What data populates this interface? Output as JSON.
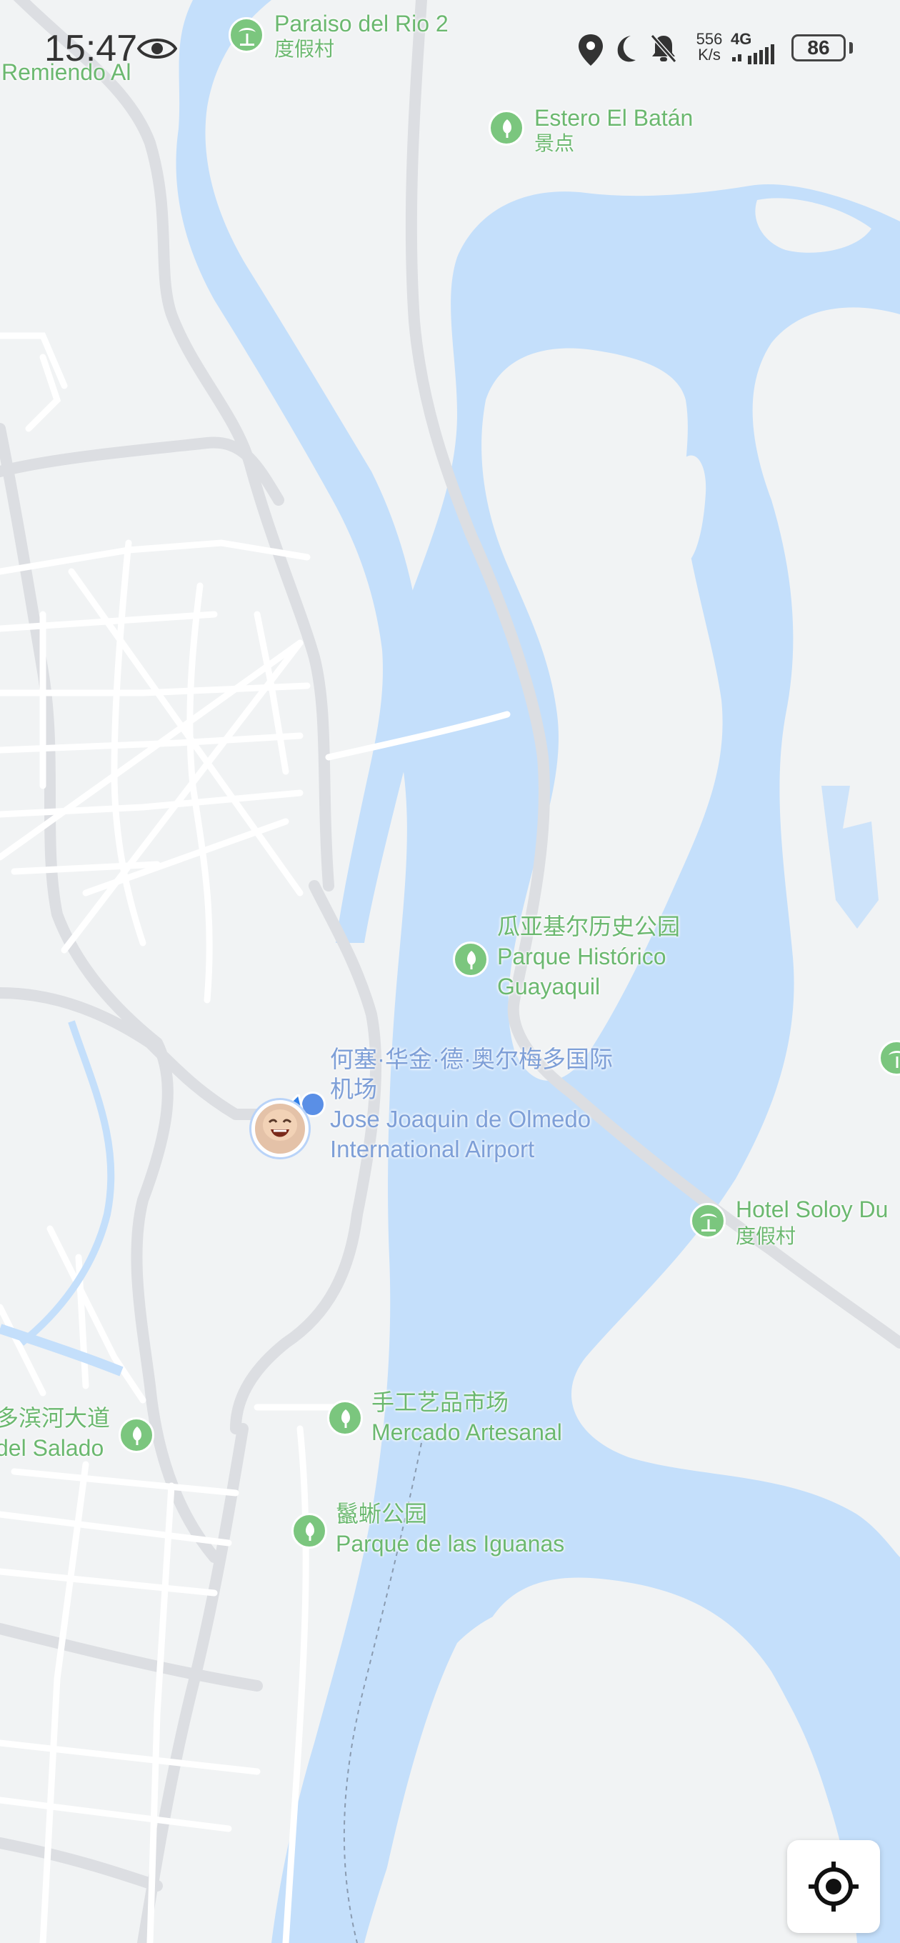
{
  "status_bar": {
    "time": "15:47",
    "network_speed_value": "556",
    "network_speed_unit": "K/s",
    "network_type": "4G",
    "battery_level": "86"
  },
  "map": {
    "top_left_street_label": "Remiendo Al",
    "pois": [
      {
        "name": "Paraiso del Rio 2",
        "category": "度假村",
        "icon": "resort-palm-icon"
      },
      {
        "name": "Estero El Batán",
        "category": "景点",
        "icon": "scenic-tree-icon"
      },
      {
        "name": "瓜亚基尔历史公园",
        "name2": "Parque Histórico",
        "name3": "Guayaquil",
        "icon": "scenic-tree-icon"
      },
      {
        "name": "Hotel Soloy Du",
        "category": "度假村",
        "icon": "resort-palm-icon"
      },
      {
        "name": "多滨河大道",
        "name2": "del Salado",
        "icon": "scenic-tree-icon"
      },
      {
        "name": "手工艺品市场",
        "name2": "Mercado Artesanal",
        "icon": "scenic-tree-icon"
      },
      {
        "name": "鬣蜥公园",
        "name2": "Parque de las Iguanas",
        "icon": "scenic-tree-icon"
      }
    ],
    "airport": {
      "name_zh_line1": "何塞·华金·德·奥尔梅多国际",
      "name_zh_line2": "机场",
      "name_en_line1": "Jose Joaquin de Olmedo",
      "name_en_line2": "International Airport"
    }
  },
  "colors": {
    "land": "#f1f3f4",
    "water": "#c4dffb",
    "road_major": "#dcdee2",
    "road_minor": "#ffffff",
    "poi_green": "#7bc67e",
    "airport_blue": "#7e9fd7",
    "location_blue": "#2f7ee6"
  }
}
